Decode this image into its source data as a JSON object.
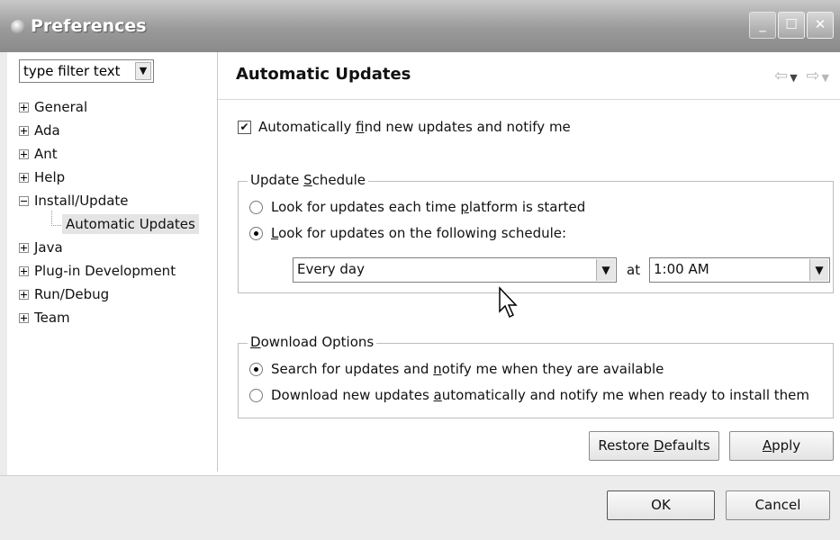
{
  "window": {
    "title": "Preferences"
  },
  "filter": {
    "value": "type filter text"
  },
  "tree": {
    "items": [
      {
        "label": "General",
        "expanded": false
      },
      {
        "label": "Ada",
        "expanded": false
      },
      {
        "label": "Ant",
        "expanded": false
      },
      {
        "label": "Help",
        "expanded": false
      },
      {
        "label": "Install/Update",
        "expanded": true
      },
      {
        "label": "Automatic Updates",
        "child": true,
        "selected": true
      },
      {
        "label": "Java",
        "expanded": false
      },
      {
        "label": "Plug-in Development",
        "expanded": false
      },
      {
        "label": "Run/Debug",
        "expanded": false
      },
      {
        "label": "Team",
        "expanded": false
      }
    ]
  },
  "page": {
    "title": "Automatic Updates",
    "auto_find": {
      "label_pre": "Automatically ",
      "label_mnemonic": "f",
      "label_post": "ind new updates and notify me",
      "checked": true
    },
    "schedule": {
      "title_pre": "Update ",
      "title_mnemonic": "S",
      "title_post": "chedule",
      "option1_pre": "Look for updates each time ",
      "option1_mnemonic": "p",
      "option1_post": "latform is started",
      "option2_mnemonic": "L",
      "option2_post": "ook for updates on the following schedule:",
      "selected_option": 2,
      "frequency": "Every day",
      "at_label": "at",
      "time": "1:00 AM"
    },
    "download": {
      "title_mnemonic": "D",
      "title_post": "ownload Options",
      "option1_pre": "Search for updates and ",
      "option1_mnemonic": "n",
      "option1_post": "otify me when they are available",
      "option2_pre": "Download new updates ",
      "option2_mnemonic": "a",
      "option2_post": "utomatically and notify me when ready to install them",
      "selected_option": 1
    },
    "restore_pre": "Restore ",
    "restore_mnemonic": "D",
    "restore_post": "efaults",
    "apply_mnemonic": "A",
    "apply_post": "pply"
  },
  "footer": {
    "ok": "OK",
    "cancel": "Cancel"
  }
}
